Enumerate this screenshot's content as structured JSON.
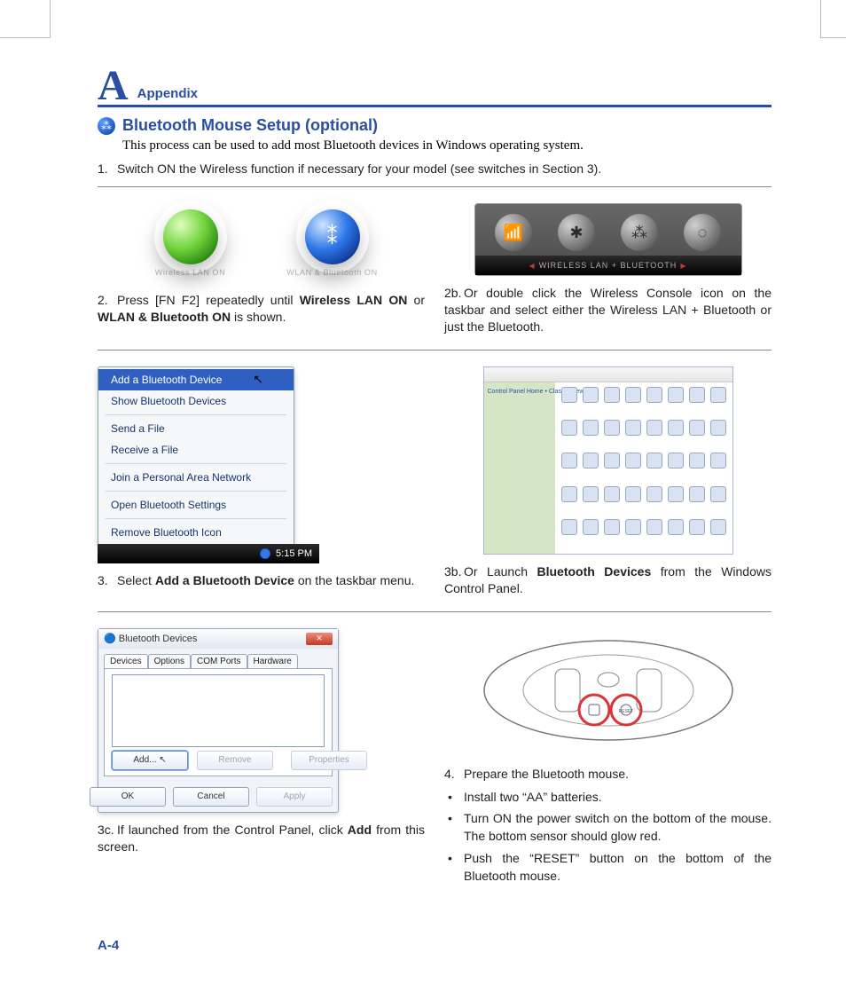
{
  "pageNumber": "A-4",
  "header": {
    "letter": "A",
    "appendix": "Appendix",
    "title": "Bluetooth Mouse Setup (optional)",
    "intro": "This process can be used to add most Bluetooth devices in Windows operating system."
  },
  "steps": {
    "s1": {
      "n": "1.",
      "t": "Switch ON the Wireless function if necessary for your model (see switches in Section 3)."
    },
    "s2": {
      "n": "2.",
      "b1": "Wireless LAN ON",
      "b2": "WLAN & Bluetooth ON"
    },
    "s2b": {
      "n": "2b.",
      "t": "Or double click the Wireless Console icon on the taskbar and select either the Wireless LAN + Bluetooth or just the Bluetooth."
    },
    "s3": {
      "n": "3.",
      "b": "Add a Bluetooth Device"
    },
    "s3b": {
      "n": "3b.",
      "b": "Bluetooth Devices"
    },
    "s3c": {
      "n": "3c.",
      "b": "Add"
    },
    "s4": {
      "n": "4.",
      "t": "Prepare the Bluetooth mouse.",
      "bul": [
        "Install two “AA” batteries.",
        "Turn ON the power switch on the bottom of the mouse. The bottom sensor should glow red.",
        "Push the “RESET” button on the bottom of the Bluetooth mouse."
      ]
    }
  },
  "fig": {
    "osd1": "Wireless LAN ON",
    "osd2": "WLAN & Bluetooth ON",
    "consoleBar": "WIRELESS LAN + BLUETOOTH",
    "cpSide": "Control Panel Home\n• Classic View"
  },
  "menu": {
    "m0": "Add a Bluetooth Device",
    "m1": "Show Bluetooth Devices",
    "m2": "Send a File",
    "m3": "Receive a File",
    "m4": "Join a Personal Area Network",
    "m5": "Open Bluetooth Settings",
    "m6": "Remove Bluetooth Icon",
    "clock": "5:15 PM"
  },
  "dlg": {
    "title": "Bluetooth Devices",
    "tabs": [
      "Devices",
      "Options",
      "COM Ports",
      "Hardware"
    ],
    "buttons": {
      "add": "Add...",
      "remove": "Remove",
      "props": "Properties",
      "ok": "OK",
      "cancel": "Cancel",
      "apply": "Apply"
    }
  }
}
